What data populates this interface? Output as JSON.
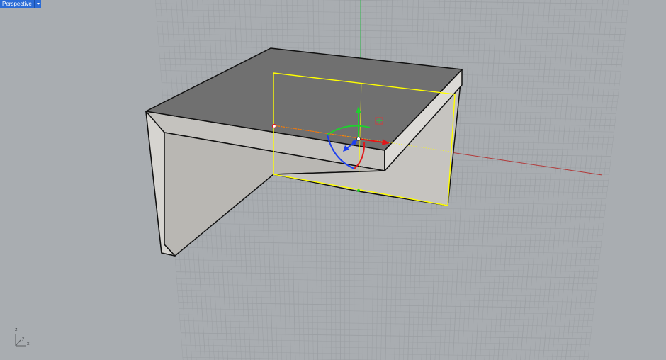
{
  "viewport": {
    "name": "Perspective",
    "menu_icon": "chevron-down-icon"
  },
  "axes_widget": {
    "z": "z",
    "y": "y",
    "x": "x"
  },
  "colors": {
    "background": "#a9adb1",
    "grid_line": "#9b9fa3",
    "x_axis": "#b23a3a",
    "y_axis": "#2fb94a",
    "selection": "#ffff00",
    "gizmo_red": "#e0171b",
    "gizmo_green": "#1fcf2f",
    "gizmo_blue": "#1c3ff0",
    "tab_blue": "#2a6bd6"
  }
}
